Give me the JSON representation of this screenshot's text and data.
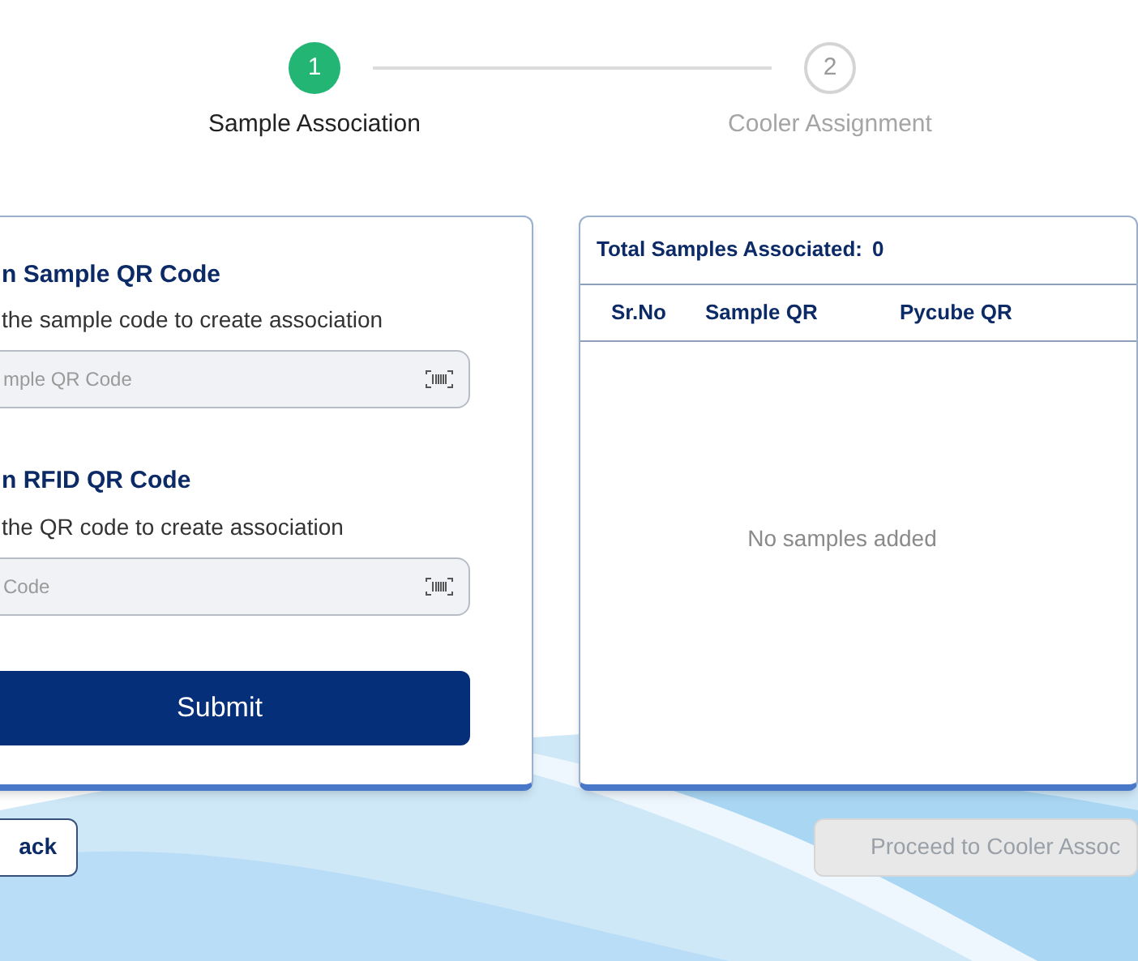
{
  "stepper": [
    {
      "number": "1",
      "label": "Sample Association",
      "selected": true
    },
    {
      "number": "2",
      "label": "Cooler Assignment",
      "selected": false
    }
  ],
  "scan_sections": [
    {
      "title": "n Sample QR Code",
      "subtitle": "the sample code to create association",
      "placeholder": "mple QR Code"
    },
    {
      "title": "n RFID QR Code",
      "subtitle": "the  QR code to create association",
      "placeholder": "Code"
    }
  ],
  "submit_button": "Submit",
  "samples_panel": {
    "total_label": "Total Samples Associated:",
    "total_count": "0",
    "columns": [
      "Sr.No",
      "Sample QR",
      "Pycube QR"
    ],
    "empty_message": "No samples added"
  },
  "back_button": "ack",
  "proceed_button": {
    "label": "Proceed to Cooler Assoc",
    "disabled": true
  }
}
